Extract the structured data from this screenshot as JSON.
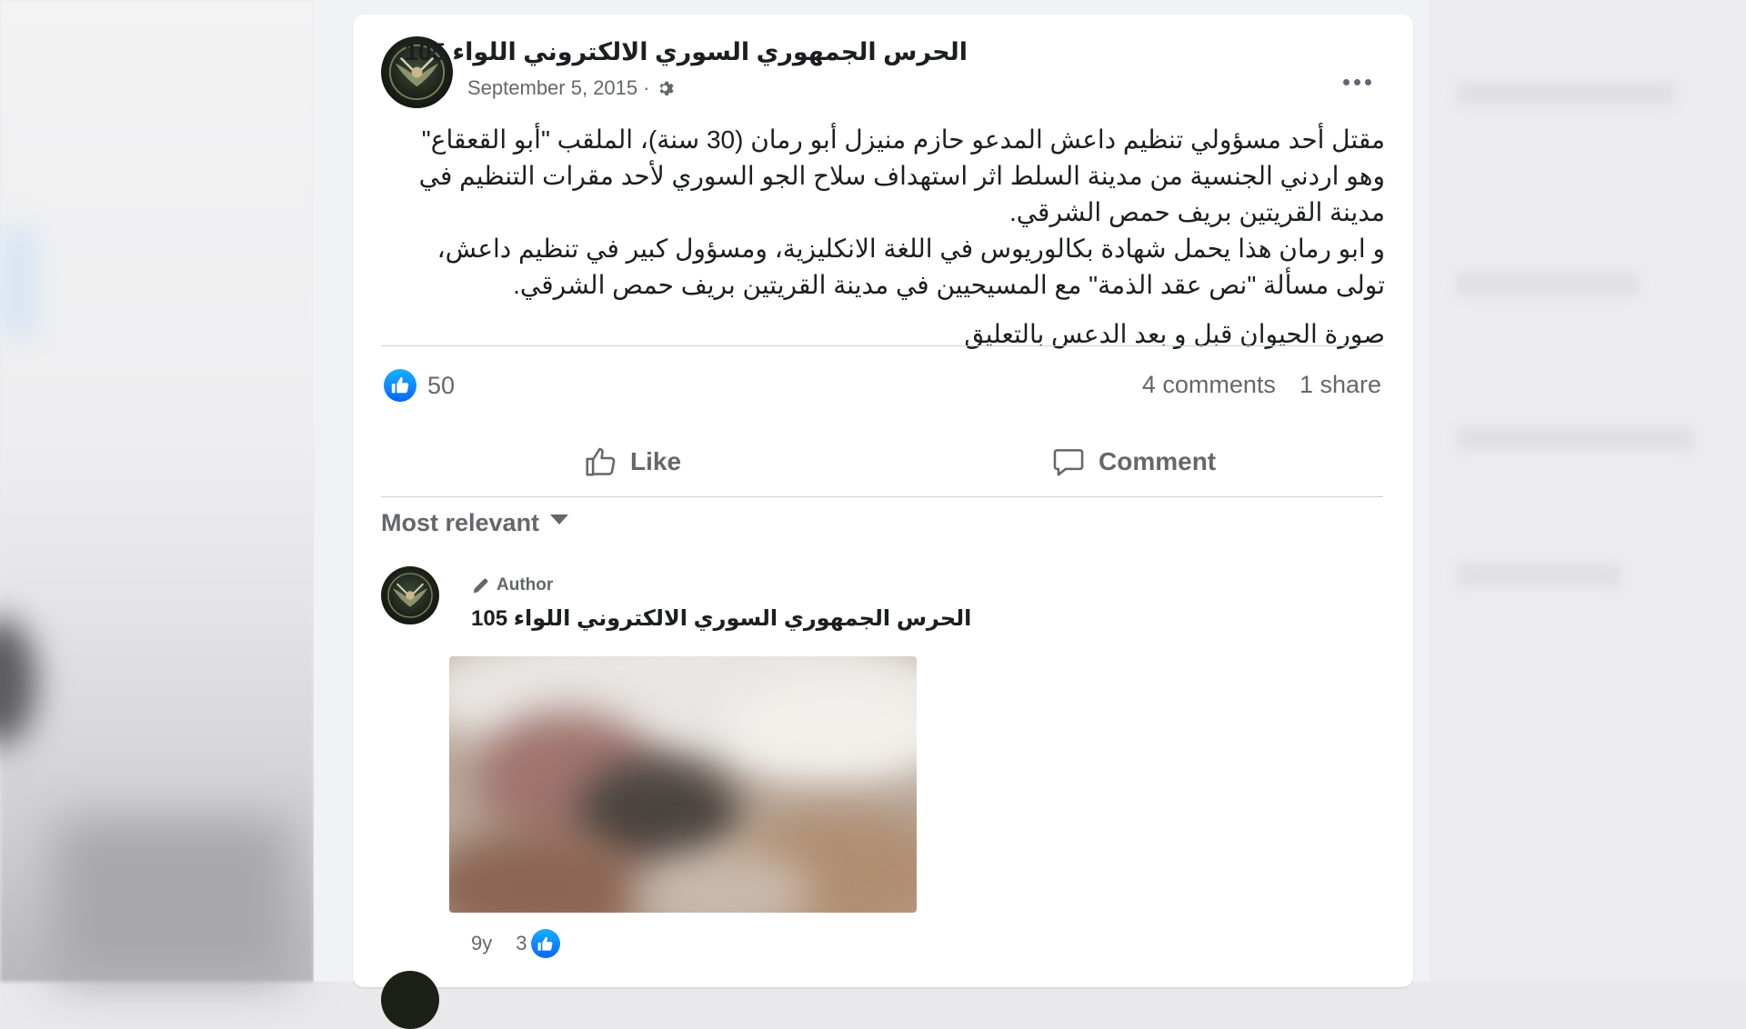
{
  "post": {
    "page_name": "الحرس الجمهوري السوري الالكتروني اللواء 105",
    "date": "September 5, 2015",
    "separator": "·",
    "privacy_icon": "gear-icon",
    "more_icon": "more-options-icon",
    "text_paragraph_1": "مقتل أحد مسؤولي تنظيم داعش المدعو حازم منيزل أبو رمان (30 سنة)، الملقب \"أبو القعقاع\" وهو اردني الجنسية من مدينة السلط اثر استهداف سلاح الجو السوري لأحد مقرات التنظيم في مدينة القريتين بريف حمص الشرقي.",
    "text_paragraph_2": "و ابو رمان هذا يحمل شهادة بكالوريوس في اللغة الانكليزية، ومسؤول كبير في تنظيم داعش، تولى مسألة \"نص عقد الذمة\" مع المسيحيين في مدينة القريتين بريف حمص الشرقي.",
    "text_paragraph_3": "صورة الحيوان قبل و بعد الدعس  بالتعليق",
    "reaction_count": "50",
    "comments_count": "4 comments",
    "shares_count": "1 share"
  },
  "actions": {
    "like_label": "Like",
    "comment_label": "Comment"
  },
  "comments_section": {
    "sort_label": "Most relevant",
    "comment": {
      "author_badge": "Author",
      "author_name": "الحرس الجمهوري السوري الالكتروني اللواء 105",
      "image_description": "blurred-photo",
      "age": "9y",
      "like_count": "3"
    }
  },
  "colors": {
    "facebook_blue": "#0866ff",
    "secondary_text": "#65676b",
    "primary_text": "#1c1e21",
    "divider": "#ced0d4"
  }
}
